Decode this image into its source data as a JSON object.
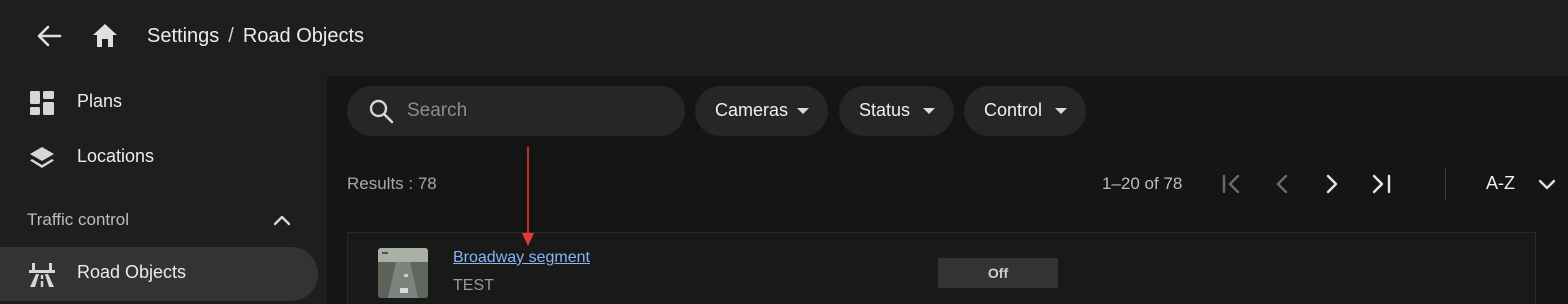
{
  "header": {
    "breadcrumb": {
      "parent": "Settings",
      "separator": "/",
      "current": "Road Objects"
    },
    "back_icon": "arrow-left-icon",
    "home_icon": "home-icon"
  },
  "sidebar": {
    "items": [
      {
        "label": "Plans",
        "icon": "dashboard-icon"
      },
      {
        "label": "Locations",
        "icon": "layers-icon"
      }
    ],
    "section": {
      "label": "Traffic control",
      "icon": "chevron-up-icon"
    },
    "active_item": {
      "label": "Road Objects",
      "icon": "road-icon"
    }
  },
  "toolbar": {
    "search": {
      "placeholder": "Search",
      "value": ""
    },
    "filters": [
      {
        "label": "Cameras"
      },
      {
        "label": "Status"
      },
      {
        "label": "Control"
      }
    ]
  },
  "results": {
    "label": "Results : 78",
    "range": "1–20 of 78",
    "sort": "A-Z"
  },
  "list": [
    {
      "title": "Broadway segment",
      "subtitle": "TEST",
      "status": "Off"
    }
  ],
  "colors": {
    "link": "#8ab4f8",
    "annotation_arrow": "#e53935",
    "background": "#1e1e1e",
    "panel": "#151515"
  }
}
